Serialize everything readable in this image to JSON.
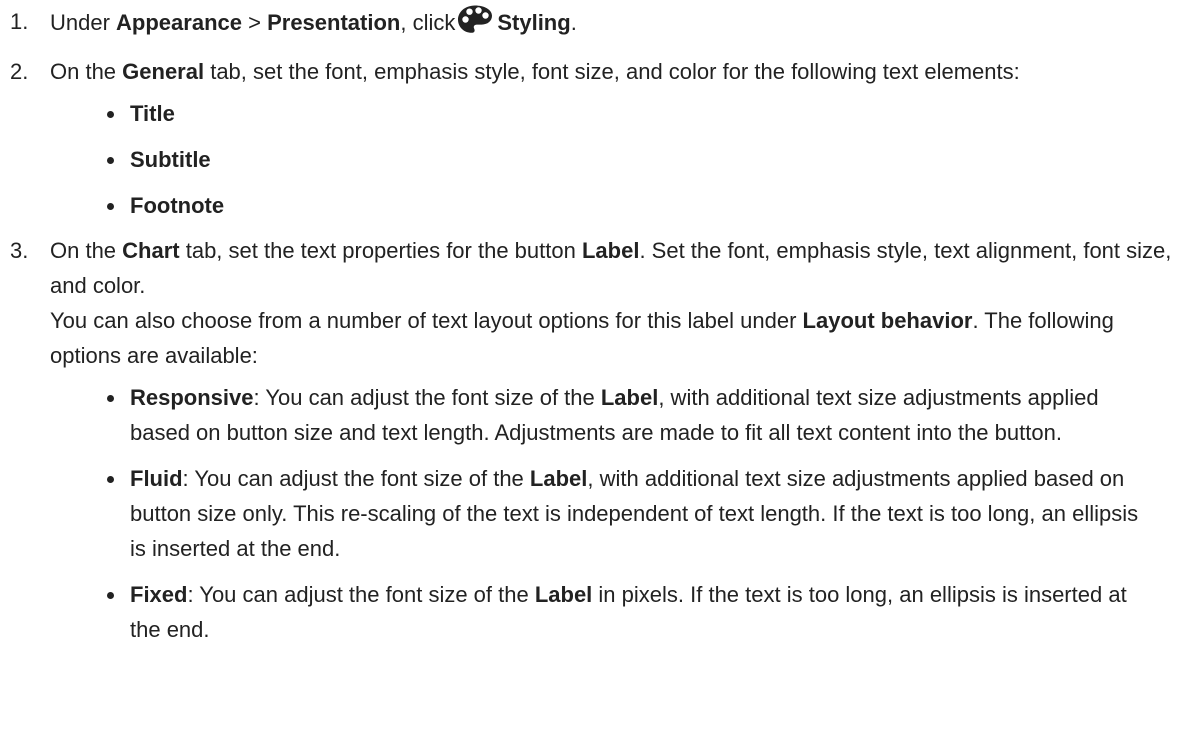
{
  "steps": [
    {
      "num": "1.",
      "t1": "Under ",
      "b1": "Appearance",
      "t2": " > ",
      "b2": "Presentation",
      "t3": ", click",
      "icon": "palette-icon",
      "b3": "Styling",
      "t4": "."
    },
    {
      "num": "2.",
      "t1": "On the ",
      "b1": "General",
      "t2": " tab, set the font, emphasis style, font size, and color for the following text elements:",
      "items": [
        "Title",
        "Subtitle",
        "Footnote"
      ]
    },
    {
      "num": "3.",
      "t1": "On the ",
      "b1": "Chart",
      "t2": " tab, set the text properties for the button ",
      "b2": "Label",
      "t3": ". Set the font, emphasis style, text alignment, font size, and color.",
      "p2_t1": "You can also choose from a number of text layout options for this label under ",
      "p2_b1": "Layout behavior",
      "p2_t2": ". The following options are available:",
      "options": [
        {
          "name": "Responsive",
          "t1": ": You can adjust the font size of the ",
          "b1": "Label",
          "t2": ", with additional text size adjustments applied based on button size and text length. Adjustments are made to fit all text content into the button."
        },
        {
          "name": "Fluid",
          "t1": ": You can adjust the font size of the ",
          "b1": "Label",
          "t2": ", with additional text size adjustments applied based on button size only. This re-scaling of the text is independent of text length. If the text is too long, an ellipsis is inserted at the end."
        },
        {
          "name": "Fixed",
          "t1": ": You can adjust the font size of the ",
          "b1": "Label",
          "t2": " in pixels. If the text is too long, an ellipsis is inserted at the end."
        }
      ]
    }
  ]
}
